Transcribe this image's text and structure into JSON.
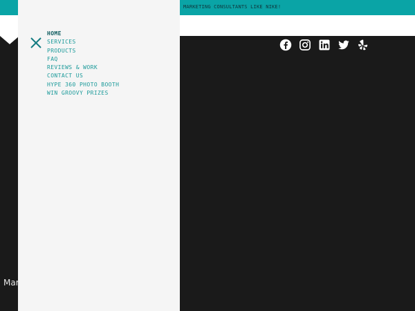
{
  "topbar": {
    "text": "MARKETING CONSULTANTS LIKE NIKE!"
  },
  "social": [
    {
      "icon": "facebook-icon"
    },
    {
      "icon": "instagram-icon"
    },
    {
      "icon": "linkedin-icon"
    },
    {
      "icon": "twitter-icon"
    },
    {
      "icon": "yelp-icon"
    }
  ],
  "bottom": {
    "text": "Mar"
  },
  "drawer": {
    "close_icon": "close-icon",
    "menu": [
      {
        "label": "HOME",
        "active": true
      },
      {
        "label": "SERVICES"
      },
      {
        "label": "PRODUCTS"
      },
      {
        "label": "FAQ"
      },
      {
        "label": "REVIEWS & WORK"
      },
      {
        "label": "CONTACT US"
      },
      {
        "label": "HYPE 360 PHOTO BOOTH"
      },
      {
        "label": "WIN GROOVY PRIZES"
      }
    ]
  },
  "colors": {
    "accent": "#0aa4a6",
    "menu_text": "#1b9a9a",
    "menu_active": "#0f5c5f",
    "drawer_bg": "#f5f5f5",
    "page_bg": "#1a1a1a"
  }
}
